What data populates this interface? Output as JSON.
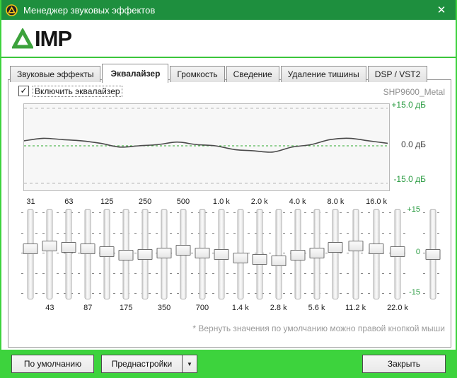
{
  "window": {
    "title": "Менеджер звуковых эффектов",
    "close_glyph": "✕"
  },
  "brand": {
    "logo_text": "IMP"
  },
  "tabs": [
    {
      "label": "Звуковые эффекты",
      "active": false
    },
    {
      "label": "Эквалайзер",
      "active": true
    },
    {
      "label": "Громкость",
      "active": false
    },
    {
      "label": "Сведение",
      "active": false
    },
    {
      "label": "Удаление тишины",
      "active": false
    },
    {
      "label": "DSP / VST2",
      "active": false
    }
  ],
  "equalizer": {
    "enable_checkbox": {
      "label": "Включить эквалайзер",
      "checked": true,
      "check_glyph": "✓"
    },
    "preset_name": "SHP9600_Metal",
    "graph": {
      "top_label": "+15.0 дБ",
      "zero_label": "0.0 дБ",
      "bottom_label": "-15.0 дБ",
      "range_db": [
        -15,
        15
      ]
    },
    "slider_scale": {
      "top": "+15",
      "zero": "0",
      "bottom": "-15"
    },
    "bands": [
      {
        "freq_label": "31",
        "label_row": "top",
        "value_db": 2.0
      },
      {
        "freq_label": "43",
        "label_row": "bottom",
        "value_db": 3.0
      },
      {
        "freq_label": "63",
        "label_row": "top",
        "value_db": 2.5
      },
      {
        "freq_label": "87",
        "label_row": "bottom",
        "value_db": 2.0
      },
      {
        "freq_label": "125",
        "label_row": "top",
        "value_db": 1.0
      },
      {
        "freq_label": "175",
        "label_row": "bottom",
        "value_db": -0.5
      },
      {
        "freq_label": "250",
        "label_row": "top",
        "value_db": 0.0
      },
      {
        "freq_label": "350",
        "label_row": "bottom",
        "value_db": 0.5
      },
      {
        "freq_label": "500",
        "label_row": "top",
        "value_db": 1.5
      },
      {
        "freq_label": "700",
        "label_row": "bottom",
        "value_db": 0.5
      },
      {
        "freq_label": "1.0 k",
        "label_row": "top",
        "value_db": 0.0
      },
      {
        "freq_label": "1.4 k",
        "label_row": "bottom",
        "value_db": -1.5
      },
      {
        "freq_label": "2.0 k",
        "label_row": "top",
        "value_db": -2.0
      },
      {
        "freq_label": "2.8 k",
        "label_row": "bottom",
        "value_db": -2.5
      },
      {
        "freq_label": "4.0 k",
        "label_row": "top",
        "value_db": -0.5
      },
      {
        "freq_label": "5.6 k",
        "label_row": "bottom",
        "value_db": 0.5
      },
      {
        "freq_label": "8.0 k",
        "label_row": "top",
        "value_db": 2.5
      },
      {
        "freq_label": "11.2 k",
        "label_row": "bottom",
        "value_db": 3.0
      },
      {
        "freq_label": "16.0 k",
        "label_row": "top",
        "value_db": 2.0
      },
      {
        "freq_label": "22.0 k",
        "label_row": "bottom",
        "value_db": 1.0
      }
    ],
    "preamp": {
      "value_db": 0.0
    },
    "footnote": "* Вернуть значения по умолчанию можно правой кнопкой мыши"
  },
  "footer": {
    "defaults_button": "По умолчанию",
    "presets_button": "Преднастройки",
    "presets_arrow": "▼",
    "close_button": "Закрыть"
  },
  "colors": {
    "titlebar_green": "#1e8f3e",
    "accent_green": "#3dd33d",
    "label_green": "#279a3f",
    "eq_zero_line": "#2daa2d",
    "curve": "#4a4a4a",
    "muted_text": "#9a9a9a"
  }
}
